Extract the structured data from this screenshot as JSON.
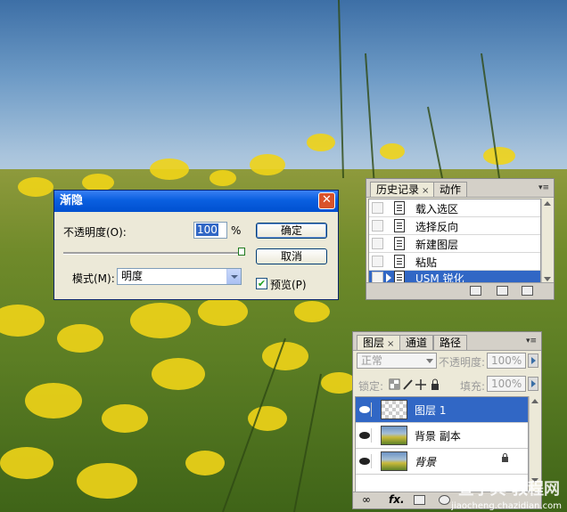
{
  "dialog": {
    "title": "渐隐",
    "close_glyph": "✕",
    "opacity_label": "不透明度(O):",
    "opacity_value": "100",
    "opacity_unit": "%",
    "opacity_slider_level": 1.0,
    "ok_label": "确定",
    "cancel_label": "取消",
    "mode_label": "模式(M):",
    "mode_value": "明度",
    "preview_label": "预览(P)",
    "preview_checked": true,
    "check_glyph": "✔"
  },
  "history_panel": {
    "tabs": [
      {
        "label": "历史记录",
        "close": "×",
        "active": true
      },
      {
        "label": "动作",
        "active": false
      }
    ],
    "menu_glyph": "▾≡",
    "items": [
      {
        "label": "载入选区",
        "selected": false
      },
      {
        "label": "选择反向",
        "selected": false
      },
      {
        "label": "新建图层",
        "selected": false
      },
      {
        "label": "粘贴",
        "selected": false
      },
      {
        "label": "USM 锐化",
        "selected": true
      }
    ]
  },
  "layers_panel": {
    "tabs": [
      {
        "label": "图层",
        "close": "×",
        "active": true
      },
      {
        "label": "通道",
        "active": false
      },
      {
        "label": "路径",
        "active": false
      }
    ],
    "menu_glyph": "▾≡",
    "blend_mode": "正常",
    "opacity_label": "不透明度:",
    "opacity_value": "100%",
    "lock_label": "锁定:",
    "fill_label": "填充:",
    "fill_value": "100%",
    "layers": [
      {
        "name": "图层 1",
        "thumb": "transparent",
        "selected": true,
        "italic": false,
        "locked": false
      },
      {
        "name": "背景 副本",
        "thumb": "photo",
        "selected": false,
        "italic": false,
        "locked": false
      },
      {
        "name": "背景",
        "thumb": "photo",
        "selected": false,
        "italic": true,
        "locked": true
      }
    ],
    "footer": {
      "link_glyph": "∞",
      "fx_label": "fx."
    }
  },
  "watermark": {
    "text": "查字典 教程网",
    "url": "jiaocheng.chazidian.com"
  },
  "colors": {
    "selection": "#3167c5",
    "dialog_title": "#0a5fe0",
    "close_button": "#d9532a"
  }
}
